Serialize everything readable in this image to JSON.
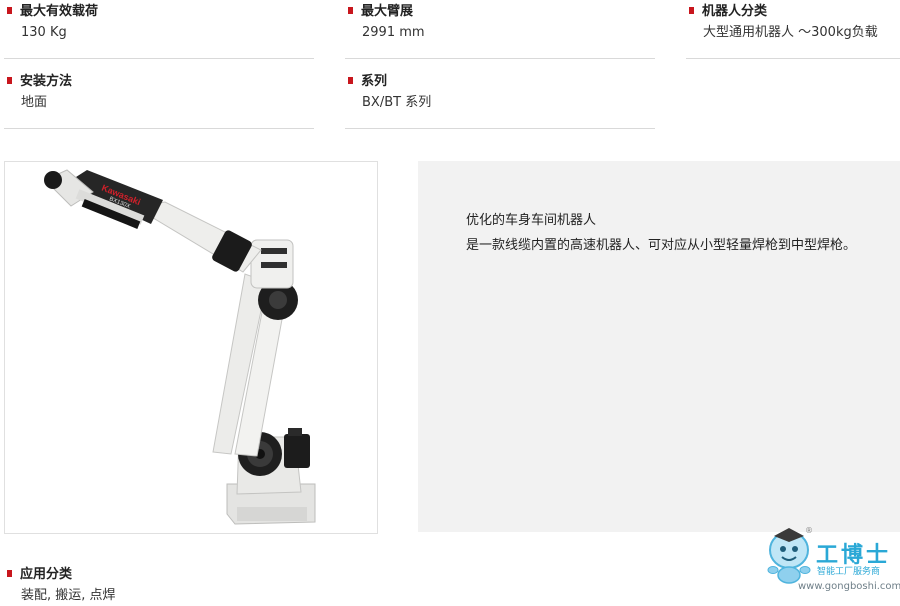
{
  "specs": {
    "max_payload": {
      "title": "最大有效载荷",
      "value": "130 Kg"
    },
    "max_reach": {
      "title": "最大臂展",
      "value": "2991 mm"
    },
    "category": {
      "title": "机器人分类",
      "value": "大型通用机器人 ～300kg负载"
    },
    "mounting": {
      "title": "安装方法",
      "value": "地面"
    },
    "series": {
      "title": "系列",
      "value": "BX/BT 系列"
    },
    "application": {
      "title": "应用分类",
      "value": "装配, 搬运, 点焊"
    }
  },
  "image": {
    "brand_label": "Kawasaki",
    "model_label": "BX130X"
  },
  "description": {
    "line1": "优化的车身车间机器人",
    "line2": "是一款线缆内置的高速机器人、可对应从小型轻量焊枪到中型焊枪。"
  },
  "watermark": {
    "name": "工博士",
    "tagline": "智能工厂服务商",
    "url": "www.gongboshi.com",
    "registered": "®"
  },
  "colors": {
    "accent_red": "#c8161d",
    "watermark_blue": "#2aa8d6",
    "panel_bg": "#f2f2f2"
  }
}
